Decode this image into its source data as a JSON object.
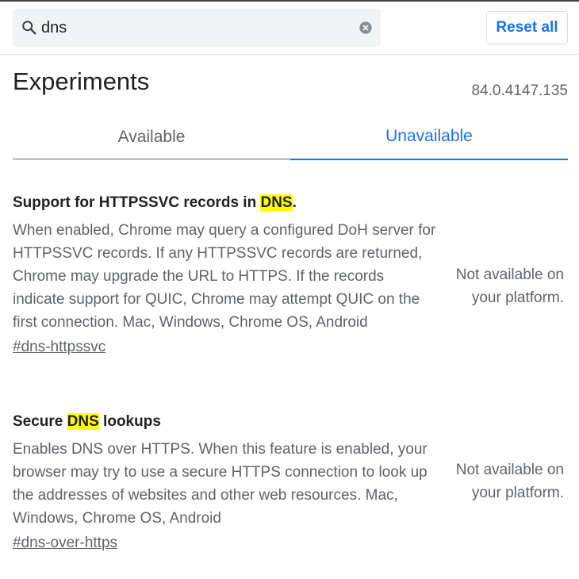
{
  "search": {
    "value": "dns",
    "search_icon": "search-icon",
    "clear_icon": "clear-icon"
  },
  "header": {
    "reset_label": "Reset all"
  },
  "page": {
    "title": "Experiments",
    "version": "84.0.4147.135"
  },
  "tabs": [
    {
      "label": "Available",
      "selected": false
    },
    {
      "label": "Unavailable",
      "selected": true
    }
  ],
  "experiments": [
    {
      "title_pre": "Support for HTTPSSVC records in ",
      "title_highlight": "DNS",
      "title_post": ".",
      "description": "When enabled, Chrome may query a configured DoH server for HTTPSSVC records. If any HTTPSSVC records are returned, Chrome may upgrade the URL to HTTPS. If the records indicate support for QUIC, Chrome may attempt QUIC on the first connection. Mac, Windows, Chrome OS, Android",
      "link": "#dns-httpssvc",
      "status": "Not available on your platform."
    },
    {
      "title_pre": "Secure ",
      "title_highlight": "DNS",
      "title_post": " lookups",
      "description": "Enables DNS over HTTPS. When this feature is enabled, your browser may try to use a secure HTTPS connection to look up the addresses of websites and other web resources. Mac, Windows, Chrome OS, Android",
      "link": "#dns-over-https",
      "status": "Not available on your platform."
    }
  ],
  "colors": {
    "accent": "#1a73e8",
    "highlight": "#ffff00",
    "secondary_text": "#5f6368"
  }
}
